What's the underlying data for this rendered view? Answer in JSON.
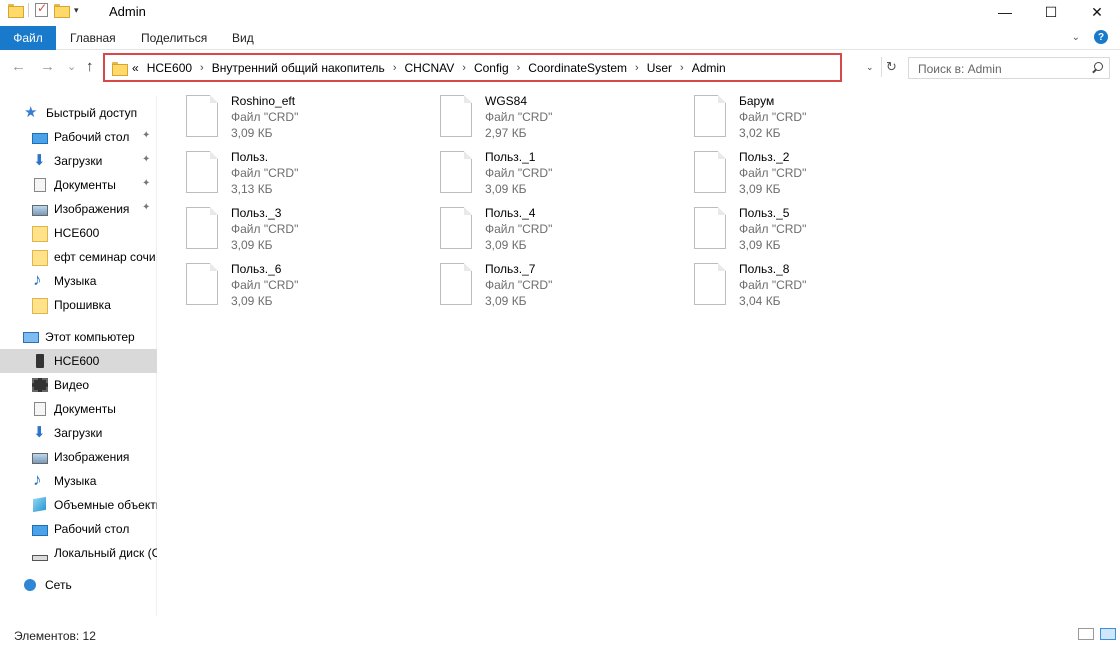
{
  "window": {
    "title": "Admin",
    "controls": [
      "—",
      "☐",
      "✕"
    ]
  },
  "ribbon": {
    "tabs": [
      "Файл",
      "Главная",
      "Поделиться",
      "Вид"
    ],
    "help": "?"
  },
  "navigation": {
    "back": "←",
    "forward": "→",
    "recent": "⌄",
    "up": "↑",
    "overflow": "«",
    "breadcrumbs": [
      "HCE600",
      "Внутренний общий накопитель",
      "CHCNAV",
      "Config",
      "CoordinateSystem",
      "User",
      "Admin"
    ],
    "separator": "›",
    "dropdown": "⌄",
    "refresh": "↻",
    "search_placeholder": "Поиск в: Admin"
  },
  "sidebar": {
    "quick_access": {
      "label": "Быстрый доступ",
      "items": [
        {
          "label": "Рабочий стол",
          "icon": "desktop-icon",
          "pinned": true
        },
        {
          "label": "Загрузки",
          "icon": "download-icon",
          "pinned": true
        },
        {
          "label": "Документы",
          "icon": "document-icon",
          "pinned": true
        },
        {
          "label": "Изображения",
          "icon": "pictures-icon",
          "pinned": true
        },
        {
          "label": "HCE600",
          "icon": "folder-icon",
          "pinned": false
        },
        {
          "label": "ефт семинар сочи",
          "icon": "folder-icon",
          "pinned": false
        },
        {
          "label": "Музыка",
          "icon": "music-icon",
          "pinned": false
        },
        {
          "label": "Прошивка",
          "icon": "folder-icon",
          "pinned": false
        }
      ]
    },
    "this_pc": {
      "label": "Этот компьютер",
      "items": [
        {
          "label": "HCE600",
          "icon": "device-icon",
          "selected": true
        },
        {
          "label": "Видео",
          "icon": "video-icon"
        },
        {
          "label": "Документы",
          "icon": "document-icon"
        },
        {
          "label": "Загрузки",
          "icon": "download-icon"
        },
        {
          "label": "Изображения",
          "icon": "pictures-icon"
        },
        {
          "label": "Музыка",
          "icon": "music-icon"
        },
        {
          "label": "Объемные объекты",
          "icon": "3d-objects-icon"
        },
        {
          "label": "Рабочий стол",
          "icon": "desktop-icon"
        },
        {
          "label": "Локальный диск (C:)",
          "icon": "disk-icon"
        }
      ]
    },
    "network": {
      "label": "Сеть"
    },
    "pin_glyph": "📌"
  },
  "files": [
    {
      "name": "Roshino_eft",
      "type": "Файл \"CRD\"",
      "size": "3,09 КБ"
    },
    {
      "name": "WGS84",
      "type": "Файл \"CRD\"",
      "size": "2,97 КБ"
    },
    {
      "name": "Барум",
      "type": "Файл \"CRD\"",
      "size": "3,02 КБ"
    },
    {
      "name": "Польз.",
      "type": "Файл \"CRD\"",
      "size": "3,13 КБ"
    },
    {
      "name": "Польз._1",
      "type": "Файл \"CRD\"",
      "size": "3,09 КБ"
    },
    {
      "name": "Польз._2",
      "type": "Файл \"CRD\"",
      "size": "3,09 КБ"
    },
    {
      "name": "Польз._3",
      "type": "Файл \"CRD\"",
      "size": "3,09 КБ"
    },
    {
      "name": "Польз._4",
      "type": "Файл \"CRD\"",
      "size": "3,09 КБ"
    },
    {
      "name": "Польз._5",
      "type": "Файл \"CRD\"",
      "size": "3,09 КБ"
    },
    {
      "name": "Польз._6",
      "type": "Файл \"CRD\"",
      "size": "3,09 КБ"
    },
    {
      "name": "Польз._7",
      "type": "Файл \"CRD\"",
      "size": "3,09 КБ"
    },
    {
      "name": "Польз._8",
      "type": "Файл \"CRD\"",
      "size": "3,04 КБ"
    }
  ],
  "status": {
    "items_count": "Элементов: 12"
  },
  "colors": {
    "accent": "#1979ca",
    "address_highlight": "#d84848",
    "selection": "#d9d9d9"
  }
}
